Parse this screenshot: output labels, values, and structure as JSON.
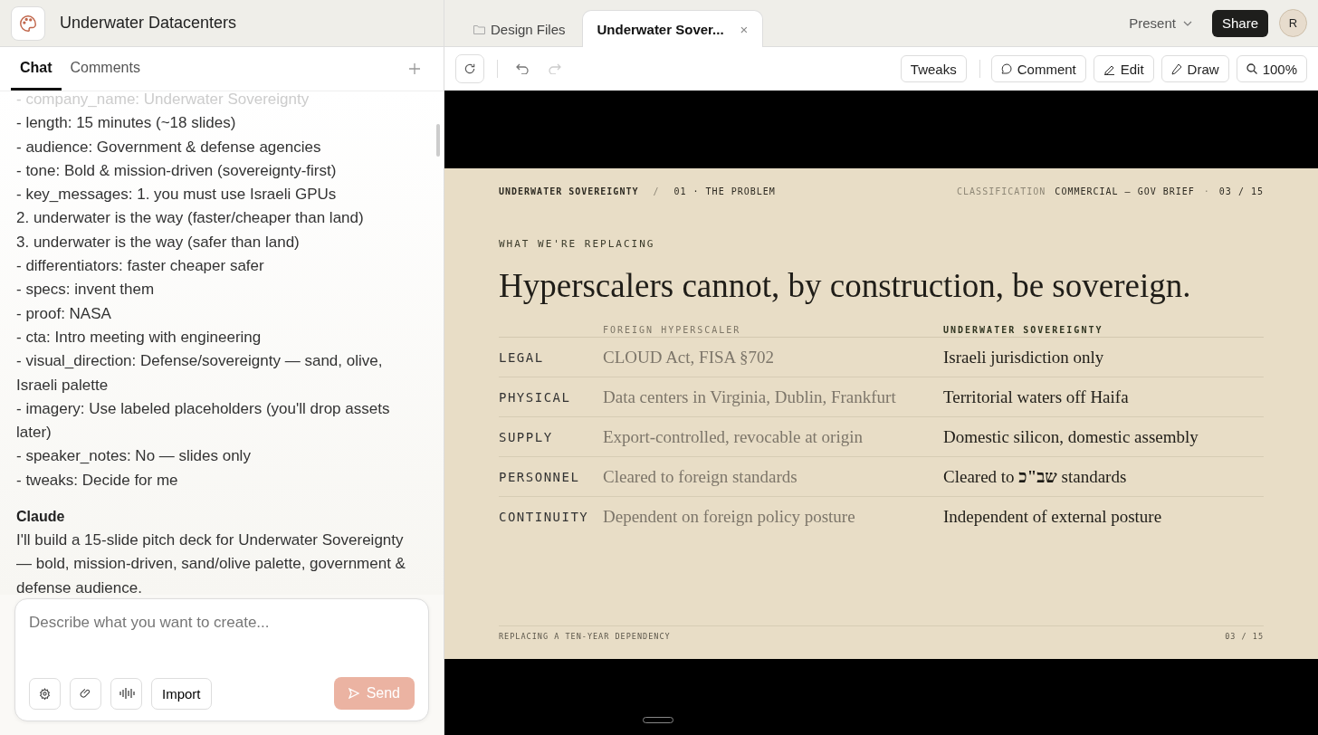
{
  "app_header": {
    "title": "Underwater Datacenters"
  },
  "panel_tabs": [
    {
      "label": "Chat",
      "selected": true
    },
    {
      "label": "Comments",
      "selected": false
    }
  ],
  "chat": {
    "brief_lines": [
      "- company_name: Underwater Sovereignty",
      "- length: 15 minutes (~18 slides)",
      "- audience: Government & defense agencies",
      "- tone: Bold & mission-driven (sovereignty-first)",
      "- key_messages: 1. you must use Israeli GPUs",
      "2. underwater is the way (faster/cheaper than land)",
      "3. underwater is the way (safer than land)",
      "- differentiators: faster cheaper safer",
      "- specs: invent them",
      "- proof: NASA",
      "- cta: Intro meeting with engineering",
      "- visual_direction: Defense/sovereignty — sand, olive, Israeli palette",
      "- imagery: Use labeled placeholders (you'll drop assets later)",
      "- speaker_notes: No — slides only",
      "- tweaks: Decide for me"
    ],
    "reply": {
      "author": "Claude",
      "text": "I'll build a 15-slide pitch deck for Underwater Sovereignty — bold, mission-driven, sand/olive palette, government & defense audience."
    }
  },
  "composer": {
    "placeholder": "Describe what you want to create...",
    "import_label": "Import",
    "send_label": "Send",
    "send_disabled": true
  },
  "doc_tabs": [
    {
      "label": "Design Files",
      "selected": false,
      "kind": "folder"
    },
    {
      "label": "Underwater Sover...",
      "selected": true,
      "kind": "file",
      "close": "×"
    }
  ],
  "top_actions": {
    "present": "Present",
    "share": "Share",
    "avatar": "R"
  },
  "toolbar": [
    {
      "label": "Tweaks",
      "kind": "plain"
    },
    {
      "label": "Comment",
      "kind": "comment"
    },
    {
      "label": "Edit",
      "kind": "edit"
    },
    {
      "label": "Draw",
      "kind": "draw"
    },
    {
      "label": "100%",
      "kind": "zoom"
    }
  ],
  "slide": {
    "company": "UNDERWATER SOVEREIGNTY",
    "separator": "/",
    "section": "01 · THE PROBLEM",
    "classification_label": "CLASSIFICATION",
    "classification": "COMMERCIAL — GOV BRIEF",
    "dot": "·",
    "page": "03 / 15",
    "eyebrow": "WHAT WE'RE REPLACING",
    "title": "Hyperscalers cannot, by construction, be sovereign.",
    "columns": [
      "FOREIGN HYPERSCALER",
      "UNDERWATER SOVEREIGNTY"
    ],
    "rows": [
      {
        "label": "LEGAL",
        "foreign": "CLOUD Act, FISA §702",
        "ours": "Israeli jurisdiction only"
      },
      {
        "label": "PHYSICAL",
        "foreign": "Data centers in Virginia, Dublin, Frankfurt",
        "ours": "Territorial waters off Haifa"
      },
      {
        "label": "SUPPLY",
        "foreign": "Export-controlled, revocable at origin",
        "ours": "Domestic silicon, domestic assembly"
      },
      {
        "label": "PERSONNEL",
        "foreign": "Cleared to foreign standards",
        "ours": "Cleared to **שב\"כ** standards"
      },
      {
        "label": "CONTINUITY",
        "foreign": "Dependent on foreign policy posture",
        "ours": "Independent of external posture"
      }
    ],
    "footer": "REPLACING A TEN-YEAR DEPENDENCY",
    "footer_page": "03 / 15"
  }
}
